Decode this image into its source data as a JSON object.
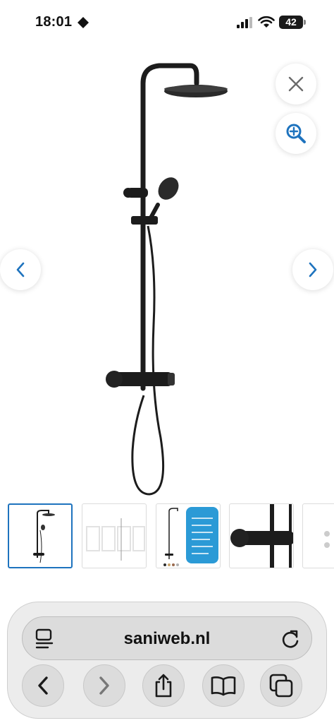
{
  "status_bar": {
    "time": "18:01",
    "battery": "42"
  },
  "icons": {
    "close": "close-icon",
    "zoom": "zoom-in-icon",
    "prev": "chevron-left-icon",
    "next": "chevron-right-icon",
    "page_menu": "page-menu-icon",
    "reload": "reload-icon",
    "back": "back-arrow-icon",
    "forward": "forward-arrow-icon",
    "share": "share-icon",
    "bookmarks": "book-icon",
    "tabs": "tabs-icon"
  },
  "colors": {
    "accent": "#1e73be",
    "product": "#1c1c1c"
  },
  "gallery": {
    "thumbnails": [
      {
        "name": "thumbnail-shower-set",
        "selected": true
      },
      {
        "name": "thumbnail-dimensions"
      },
      {
        "name": "thumbnail-features"
      },
      {
        "name": "thumbnail-thermostat-closeup"
      },
      {
        "name": "thumbnail-partial"
      }
    ]
  },
  "browser": {
    "url": "saniweb.nl"
  }
}
